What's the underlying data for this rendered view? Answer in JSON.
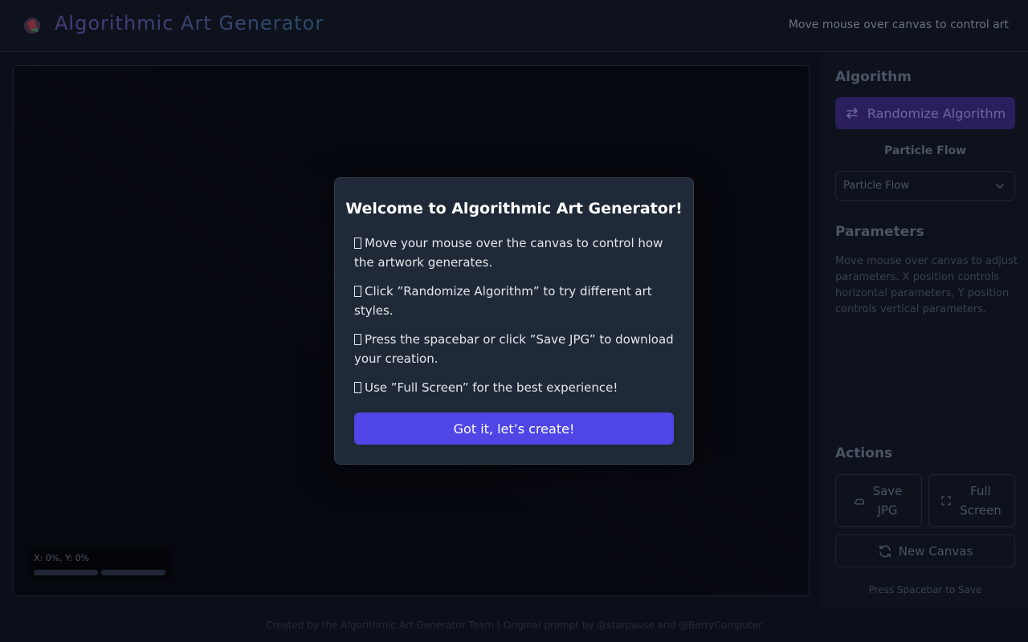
{
  "header": {
    "title": "Algorithmic Art Generator",
    "hint": "Move mouse over canvas to control art"
  },
  "canvas": {
    "coords": "X: 0%, Y: 0%",
    "x_progress": 0,
    "y_progress": 0
  },
  "sidebar": {
    "algorithm_title": "Algorithm",
    "randomize_label": "Randomize Algorithm",
    "current_algorithm": "Particle Flow",
    "select_value": "Particle Flow",
    "parameters_title": "Parameters",
    "parameters_text": "Move mouse over canvas to adjust parameters. X position controls horizontal parameters, Y position controls vertical parameters.",
    "actions_title": "Actions",
    "save_label_1": "Save",
    "save_label_2": "JPG",
    "fullscreen_label_1": "Full",
    "fullscreen_label_2": "Screen",
    "new_canvas_label": "New Canvas",
    "spacebar_hint": "Press Spacebar to Save"
  },
  "footer": {
    "text": "Created by the Algorithmic Art Generator Team | Original prompt by @starpause and @BerryComputer"
  },
  "modal": {
    "title": "Welcome to Algorithmic Art Generator!",
    "line1": "Move your mouse over the canvas to control how the artwork generates.",
    "line2": "Click ”Randomize Algorithm” to try different art styles.",
    "line3": "Press the spacebar or click ”Save JPG” to download your creation.",
    "line4": "Use ”Full Screen” for the best experience!",
    "button_label": "Got it, let’s create!"
  },
  "colors": {
    "accent": "#4f46e5",
    "modal_bg": "#1f2937",
    "page_bg": "#0b0f19"
  }
}
